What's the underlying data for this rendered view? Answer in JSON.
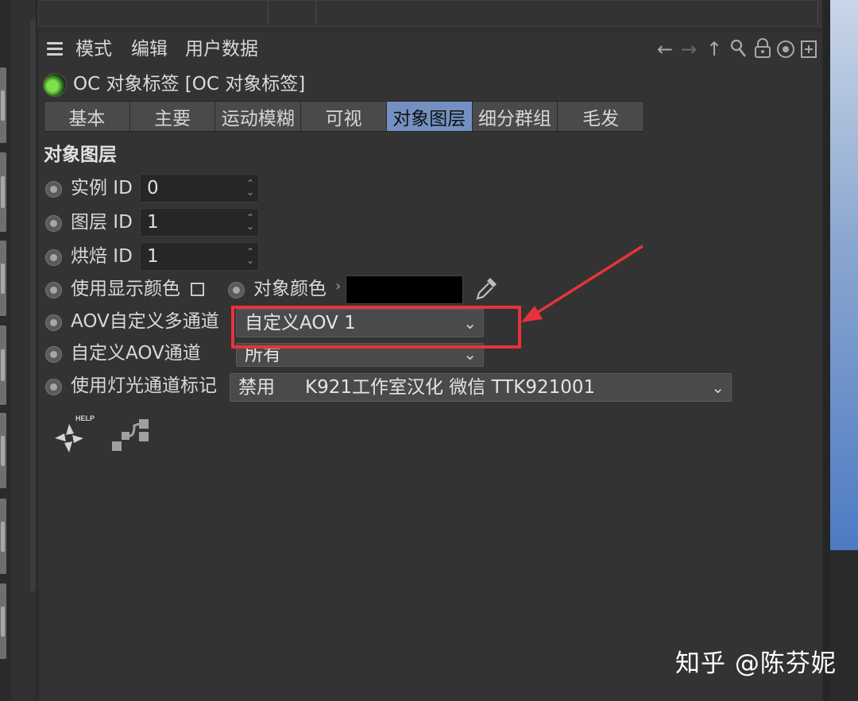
{
  "menu": {
    "items": [
      "模式",
      "编辑",
      "用户数据"
    ]
  },
  "nav_icons": [
    "arrow-left-icon",
    "arrow-right-icon",
    "arrow-up-icon",
    "search-icon",
    "lock-icon",
    "target-icon",
    "add-panel-icon"
  ],
  "object": {
    "title": "OC 对象标签 [OC 对象标签]"
  },
  "tabs": [
    {
      "label": "基本",
      "active": false
    },
    {
      "label": "主要",
      "active": false
    },
    {
      "label": "运动模糊",
      "active": false
    },
    {
      "label": "可视",
      "active": false
    },
    {
      "label": "对象图层",
      "active": true
    },
    {
      "label": "细分群组",
      "active": false
    },
    {
      "label": "毛发",
      "active": false
    }
  ],
  "section_title": "对象图层",
  "fields": {
    "instance_id": {
      "label": "实例 ID",
      "value": "0"
    },
    "layer_id": {
      "label": "图层 ID",
      "value": "1"
    },
    "bake_id": {
      "label": "烘焙 ID",
      "value": "1"
    },
    "use_display_color": {
      "label": "使用显示颜色",
      "checked": false
    },
    "object_color": {
      "label": "对象颜色",
      "color": "#000000"
    },
    "aov_custom": {
      "label": "AOV自定义多通道",
      "value": "自定义AOV 1"
    },
    "custom_aov_channel": {
      "label": "自定义AOV通道",
      "value": "所有"
    },
    "light_pass": {
      "label": "使用灯光通道标记",
      "value": "禁用",
      "note": "K921工作室汉化 微信 TTK921001"
    }
  },
  "help_badge": "HELP",
  "watermark": "知乎 @陈芬妮",
  "colors": {
    "accent_tab": "#7490c2",
    "highlight": "#e8323a",
    "panel_bg": "#333333"
  }
}
